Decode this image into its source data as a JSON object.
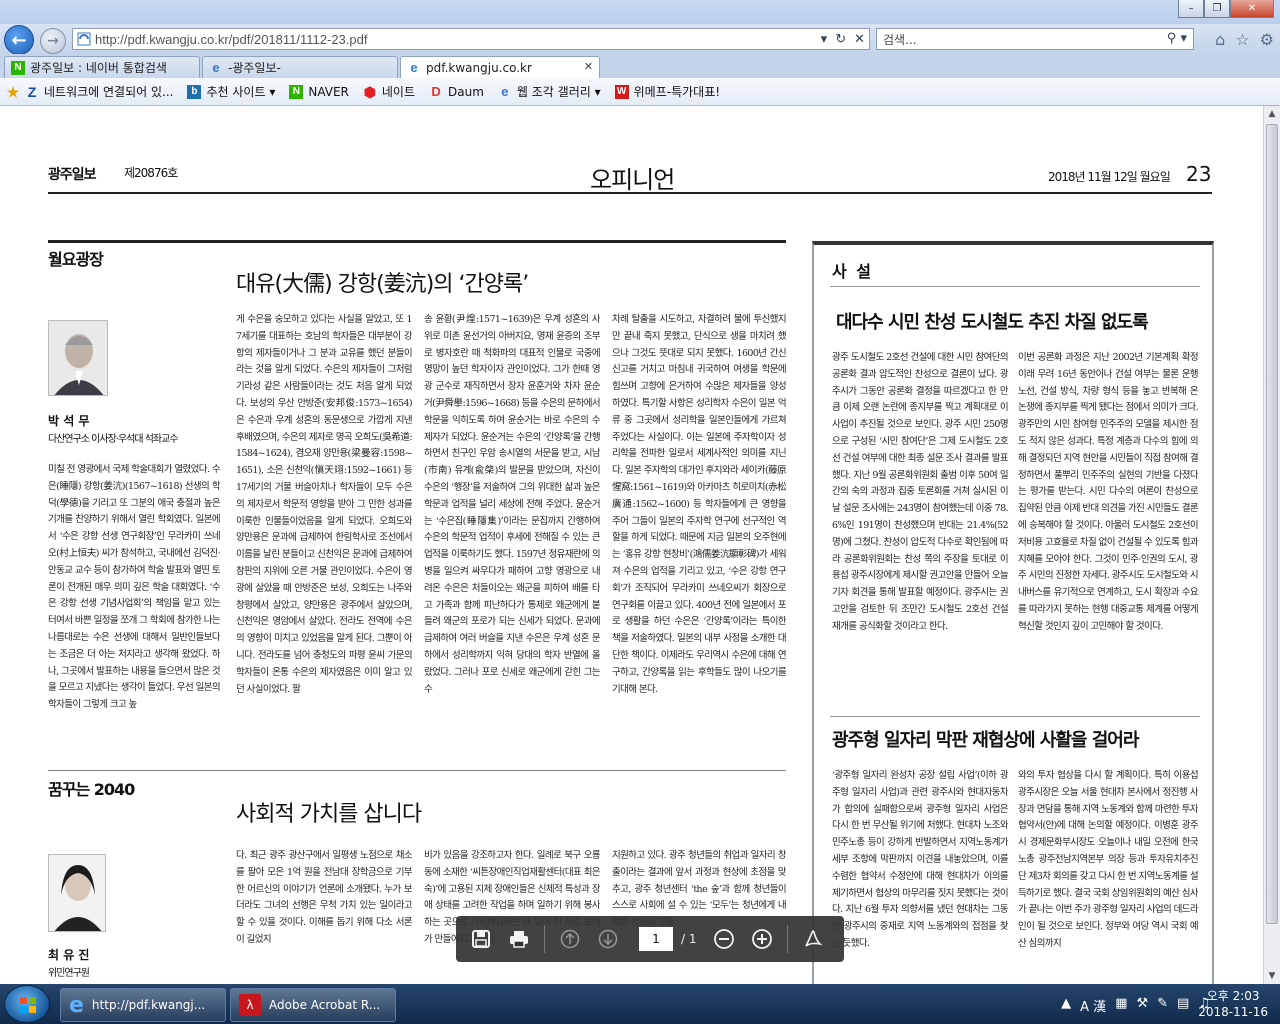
{
  "browser": {
    "address": "http://pdf.kwangju.co.kr/pdf/201811/1112-23.pdf",
    "search_placeholder": "검색...",
    "tabs": [
      {
        "label": "광주일보 : 네이버 통합검색"
      },
      {
        "label": "-광주일보-"
      },
      {
        "label": "pdf.kwangju.co.kr"
      }
    ],
    "favorites": [
      {
        "label": "네트워크에 연결되어 있..."
      },
      {
        "label": "추천 사이트 ▾"
      },
      {
        "label": "NAVER"
      },
      {
        "label": "네이트"
      },
      {
        "label": "Daum"
      },
      {
        "label": "웹 조각 갤러리 ▾"
      },
      {
        "label": "위메프-특가대표!"
      }
    ]
  },
  "paper": {
    "name": "광주일보",
    "issue": "제20876호",
    "section": "오피니언",
    "date": "2018년 11월 12일 월요일",
    "page": "23",
    "column1": {
      "header": "월요광장",
      "headline": "대유(大儒) 강항(姜沆)의 ‘간양록’",
      "author": "박 석 무",
      "author_title": "다산연구소 이사장·우석대 석좌교수",
      "texts": [
        "미칠 전 영광에서 국제 학술대회가 열렸었다. 수은(睡隱) 강항(姜沆)(1567~1618) 선생의 학덕(學德)을 기리고 또 그분의 애국 충절과 높은 기개를 찬양하기 위해서 열린 학회였다. 일본에서 ‘수은 강항 선생 연구회장’인 무라카미 쓰네오(村上恒夫) 씨가 참석하고, 국내에선 김덕진·안동교 교수 등이 참가하여 학술 발표와 열띤 토론이 전개된 매우 의미 깊은 학술 대회였다. ‘수은 강항 선생 기념사업회’의 책임을 맡고 있는 터여서 바쁜 일정을 쪼개 그 학회에 참가한 나는 나름대로는 수은 선생에 대해서 일반인들보다는 조금은 더 아는 처지라고 생각해 왔었다. 하나, 그곳에서 발표하는 내용을 들으면서 많은 것을 모르고 지냈다는 생각이 들었다. 우선 일본의 학자들이 그렇게 크고 높",
        "게 수은을 숭모하고 있다는 사실을 알았고, 또 17세기를 대표하는 호남의 학자들은 대부분이 강항의 제자들이거나 그 분과 교유를 했던 분들이라는 것을 알게 되었다. 수은의 제자들이 그처럼 기라성 같은 사람들이라는 것도 처음 알게 되었다. 보성의 우산 안방준(安邦俊:1573~1654)은 수은과 우계 성혼의 동문생으로 가깝게 지낸 후배였으며, 수은의 제자로 명곡 오희도(吳希道:1584~1624), 겸오재 양만용(梁曼容:1598~1651), 소은 신천익(愼天翊:1592~1661) 등 17세기의 거물 버슬아치나 학자들이 모두 수은의 제자로서 학문적 영향을 받아 그 만한 성과를 이룩한 인물들이었음을 알게 되었다. 오희도와 양만용은 문과에 급제하여 한림학사로 조선에서 이름을 날린 분들이고 신천익은 문과에 급제하여 참판의 지위에 오른 거물 관인이었다. 수은이 영광에 살았을 때 안방준은 보성, 오희도는 나주와 창평에서 살았고, 양만용은 광주에서 살았으며, 신천익은 영암에서 살았다. 전라도 전역에 수은의 영향이 미치고 있었음을 알게 된다. 그뿐이 아니다. 전라도를 넘어 충청도의 파평 윤씨 가문의 학자들이 온통 수은의 제자였음은 이미 알고 있던 사실이었다. 팔",
        "송 윤황(尹煌:1571~1639)은 우계 성혼의 사위로 미촌 윤선거의 아버지요, 명재 윤증의 조부로 병자호란 때 척화파의 대표적 인물로 국중에 명망이 높던 학자이자 관인이었다. 그가 한때 영광 군수로 재직하면서 장자 윤훈거와 차자 윤순거(尹舜擧:1596~1668) 등을 수은의 문하에서 학문을 익히도록 하여 윤순거는 바로 수은의 수제자가 되었다. 윤순거는 수은의 ‘간양록’을 간행하면서 친구인 우암 송시열의 서문을 받고, 시남(市南) 유계(兪棨)의 발문을 받았으며, 자신이 수은의 ‘행장’을 저술하여 그의 위대한 삶과 높은 학문과 업적을 널리 세상에 전해 주었다. 윤순거는 ‘수은집(睡隱集)’이라는 문집까지 간행하여 수은의 학문적 업적이 후세에 전해질 수 있는 큰 업적을 이룩하기도 했다. 1597년 정유재란에 의병을 일으켜 싸우다가 패하여 고향 영광으로 내려온 수은은 처들이오는 왜군을 피하여 배를 타고 가족과 함께 피난하다가 통제로 왜군에게 붙들려 왜군의 포로가 되는 신세가 되었다. 문과에 급제하여 여러 버슬을 지낸 수은은 우계 성혼 문하에서 성리학까지 익혀 당대의 학자 반열에 올랐었다. 그러나 포로 신세로 왜군에게 갇힌 그는 수",
        "차례 탈출을 시도하고, 자결하려 물에 투신했지만 끝내 죽지 못했고, 단식으로 생을 마치려 했으나 그것도 뜻대로 되지 못했다. 1600년 간신신고를 거치고 마침내 귀국하여 여생을 학문에 힘쓰며 고향에 은거하여 수많은 제자들을 양성하였다. 특기할 사항은 성리학자 수은이 일본 억류 중 그곳에서 성리학을 일본인들에게 가르쳐주었다는 사실이다. 이는 일본에 주자학이자 성리학을 전파한 일로서 세계사적인 의미를 지닌다. 일본 주자학의 대가인 후지와라 세이카(藤原惺窩:1561~1619)와 아카마츠 히로미치(赤松廣通:1562~1600) 등 학자들에게 큰 영향을 주어 그들이 일본의 주자학 연구에 선구적인 역할을 하게 되었다. 때문에 지금 일본의 오주현에는 ‘홍유 강항 현창비’(鴻儒姜沆顯彰碑)가 세워져 수은의 업적을 기리고 있고, ‘수은 강항 연구회’가 조직되어 무라카미 쓰네오씨가 회장으로 연구회를 이끌고 있다. 400년 전에 일본에서 포로 생활을 하던 수은은 ‘간양록’이라는 특이한 책을 저술하였다. 일본의 내부 사정을 소개한 대단한 책이다. 이제라도 우리역시 수은에 대해 연구하고, 간양록을 읽는 후학들도 많이 나오기를 기대해 본다."
      ]
    },
    "column2": {
      "header": "꿈꾸는 2040",
      "headline": "사회적 가치를 삽니다",
      "author": "최 유 진",
      "author_title": "위민연구원",
      "texts": [
        "다. 최근 광주 광산구에서 일평생 노점으로 채소를 팔아 모은 1억 원을 전남대 장학금으로 기부한 어르신의 이야기가 언론에 소개됐다. 누가 보더라도 그녀의 선행은 무척 가치 있는 일이라고 할 수 있을 것이다. 이해를 돕기 위해 다소 서론이 길었지",
        "비가 있음을 강조하고자 한다. 일례로 북구 오룡동에 소재한 ‘씨튼장애인직업재활센터(대표 최은숙)’에 고용된 지체 장애인들은 신체적 특성과 장애 상태를 고려한 작업을 하며 일하기 위해 봉사하는 곳으로 자리매김하는 데 있어 적 자립 토대가 만들어지고 있다.",
        "지원하고 있다. 광주 청년들의 취업과 일자리 창출이라는 결과에 앞서 과정과 현상에 초점을 맞추고, 광주 청년센터 ‘the 숲’과 함께 청년들이 스스로 사회에 설 수 있는 ‘모두’는 청년에게 내재한 상처와 고통"
      ]
    },
    "editorial": {
      "label": "사 설",
      "headline1": "대다수 시민 찬성 도시철도 추진 차질 없도록",
      "texts1": [
        "광주 도시철도 2호선 건설에 대한 시민 참여단의 공론화 결과 압도적인 찬성으로 결론이 났다. 광주시가 그동안 공론화 결정을 따르겠다고 한 만큼 이제 오랜 논란에 종지부를 찍고 계획대로 이 사업이 추진될 것으로 보인다. 광주 시민 250명으로 구성된 ‘시민 참여단’은 그제 도시철도 2호선 건설 여부에 대한 최종 설문 조사 결과를 발표했다. 지난 9월 공론화위원회 출범 이후 50여 일간의 숙의 과정과 집중 토론회를 거쳐 실시된 이날 설문 조사에는 243명이 참여했는데 이중 78.6%인 191명이 찬성했으며 반대는 21.4%(52명)에 그쳤다. 찬성이 압도적 다수로 확인됨에 따라 공론화위원회는 찬성 쪽의 주장을 토대로 이용섭 광주시장에게 제시할 권고안을 만들어 오늘 기자 회견을 통해 발표할 예정이다. 광주시는 권고안을 검토한 뒤 조만간 도시철도 2호선 건설 재개를 공식화할 것이라고 한다.",
        "이번 공론화 과정은 지난 2002년 기본계획 확정 이래 무려 16년 동안이나 건설 여부는 물론 운행 노선, 건설 방식, 차량 형식 등을 놓고 반복해 온 논쟁에 종지부를 찍게 됐다는 점에서 의미가 크다. 광주만의 시민 참여형 민주주의 모델을 제시한 점도 적지 않은 성과다. 특정 계층과 다수의 힘에 의해 결정되던 지역 현안을 시민들이 직접 참여해 결정하면서 풀뿌리 민주주의 실현의 기반을 다졌다는 평가를 받는다. 시민 다수의 여론이 찬성으로 집약된 만큼 이제 반대 의견을 가진 시민들도 결론에 승복해야 할 것이다. 아울러 도시철도 2호선이 저비용 고효율로 차질 없이 건설될 수 있도록 힘과 지혜를 모아야 한다. 그것이 민주·인권의 도시, 광주 시민의 진정한 자세다. 광주시도 도시철도와 시내버스를 유기적으로 연계하고, 도시 확장과 수요를 따라가지 못하는 현행 대중교통 체계를 어떻게 혁신할 것인지 깊이 고민해야 할 것이다."
      ],
      "headline2": "광주형 일자리 막판 재협상에 사활을 걸어라",
      "texts2": [
        "‘광주형 일자리 완성차 공장 설립 사업’(이하 광주형 일자리 사업)과 관련 광주시와 현대자동차가 합의에 실패함으로써 광주형 일자리 사업은 다시 한 번 무산될 위기에 처했다. 현대차 노조와 민주노총 등이 강하게 반발하면서 지역노동계가 세부 조항에 막판까지 이견을 내놓았으며, 이를 수렴한 협약서 수정안에 대해 현대차가 이의를 제기하면서 협상의 마무리를 짓지 못했다는 것이다. 지난 6월 투자 의향서를 냈던 현대차는 그동안 광주시의 중재로 지역 노동계와의 접점을 찾는 듯했다.",
        "와의 투자 협상을 다시 할 계획이다. 특히 이용섭 광주시장은 오늘 서울 현대차 본사에서 정진행 사장과 면담을 통해 지역 노동계와 함께 마련한 투자협약서(안)에 대해 논의할 예정이다. 이병훈 광주시 경제문화부시장도 오늘이나 내일 오전에 한국노총 광주전남지역본부 의장 등과 투자유치추진단 제3차 회의를 갖고 다시 한 번 지역노동계를 설득하기로 했다. 결국 국회 상임위원회의 예산 심사가 끝나는 이번 주가 광주형 일자리 사업의 데드라인이 될 것으로 보인다. 정부와 여당 역시 국회 예산 심의까지"
      ]
    }
  },
  "pdf_toolbar": {
    "page_current": "1",
    "page_total": "/ 1"
  },
  "taskbar": {
    "items": [
      {
        "label": "http://pdf.kwangj..."
      },
      {
        "label": "Adobe Acrobat R..."
      }
    ],
    "time": "오후 2:03",
    "date": "2018-11-16",
    "ime": "A 漢"
  },
  "colors": {
    "accent_blue": "#1f5fb8",
    "ink": "#111111",
    "toolbar_bg": "#323232"
  }
}
